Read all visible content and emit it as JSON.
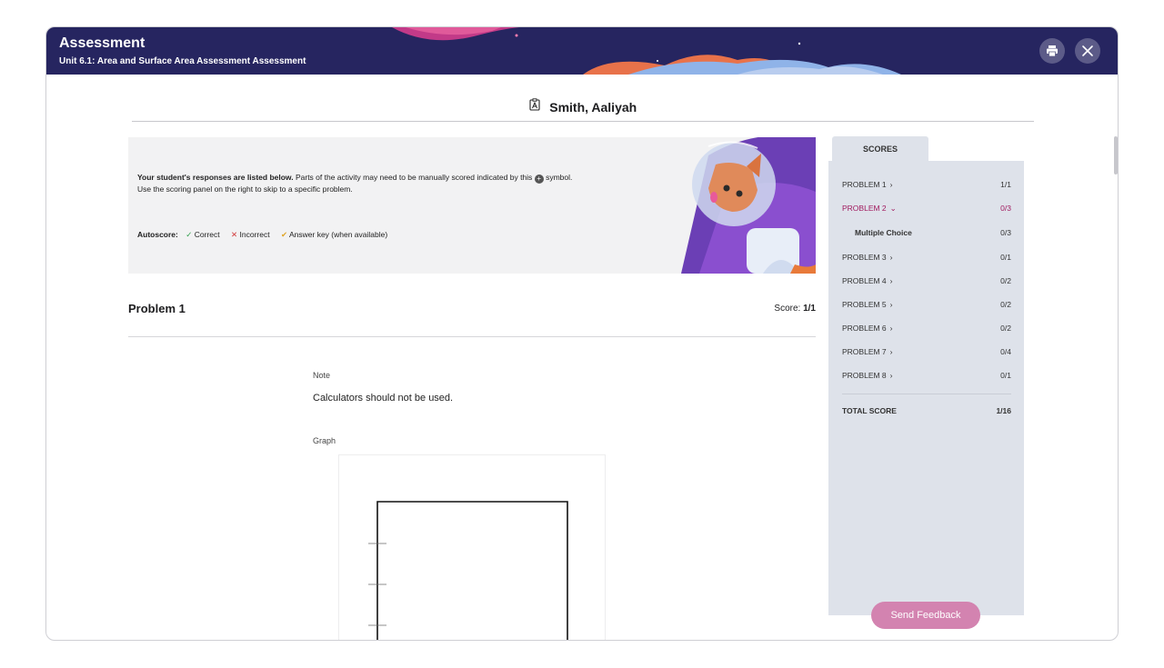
{
  "header": {
    "title": "Assessment",
    "subtitle": "Unit 6.1: Area and Surface Area Assessment Assessment",
    "print_icon": "printer-icon",
    "close_icon": "close-icon"
  },
  "student": {
    "name": "Smith, Aaliyah",
    "icon": "student-badge-icon"
  },
  "banner": {
    "intro_bold": "Your student's responses are listed below.",
    "intro_rest": "Parts of the activity may need to be manually scored indicated by this",
    "intro_symbol": "symbol.",
    "intro_line2": "Use the scoring panel on the right to skip to a specific problem.",
    "autoscore_label": "Autoscore:",
    "legend": {
      "correct": "Correct",
      "incorrect": "Incorrect",
      "answer_key": "Answer key (when available)"
    },
    "colors": {
      "correct": "#2e9e4a",
      "incorrect": "#d23b3b",
      "answer_key": "#e0a526"
    }
  },
  "problem": {
    "title": "Problem 1",
    "score_prefix": "Score:",
    "score_value": "1/1",
    "note_label": "Note",
    "note_text": "Calculators should not be used.",
    "graph_label": "Graph"
  },
  "scores": {
    "tab_label": "SCORES",
    "rows": [
      {
        "label": "PROBLEM 1",
        "value": "1/1"
      },
      {
        "label": "PROBLEM 2",
        "value": "0/3"
      },
      {
        "label": "Multiple Choice",
        "value": "0/3"
      },
      {
        "label": "PROBLEM 3",
        "value": "0/1"
      },
      {
        "label": "PROBLEM 4",
        "value": "0/2"
      },
      {
        "label": "PROBLEM 5",
        "value": "0/2"
      },
      {
        "label": "PROBLEM 6",
        "value": "0/2"
      },
      {
        "label": "PROBLEM 7",
        "value": "0/4"
      },
      {
        "label": "PROBLEM 8",
        "value": "0/1"
      }
    ],
    "total_label": "TOTAL SCORE",
    "total_value": "1/16",
    "active_color": "#a11b5f"
  },
  "feedback_button": "Send Feedback"
}
